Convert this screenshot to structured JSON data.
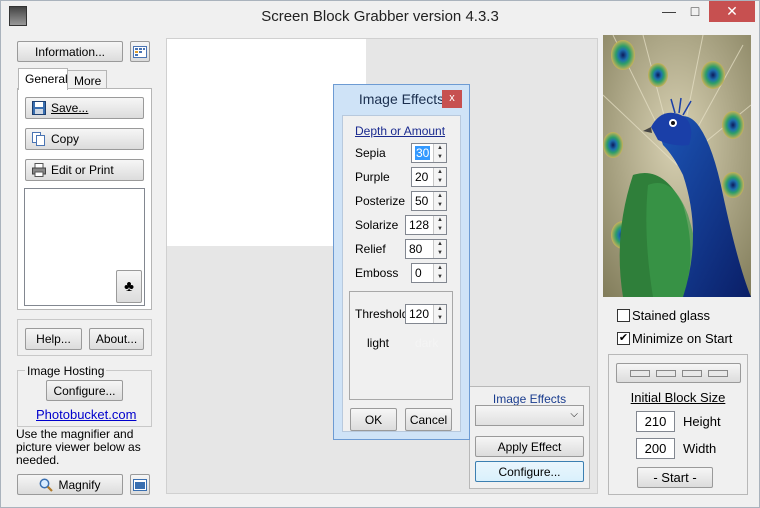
{
  "window": {
    "title": "Screen Block Grabber   version 4.3.3",
    "minimize": "—",
    "restore": "□",
    "close": "✕"
  },
  "left_panel": {
    "information_button": "Information...",
    "tabs": [
      {
        "label": "General",
        "active": true
      },
      {
        "label": "More",
        "active": false
      }
    ],
    "save_button": "Save...",
    "copy_button": "Copy",
    "edit_print_button": "Edit or Print",
    "club_glyph": "♣",
    "help_button": "Help...",
    "about_button": "About...",
    "image_hosting_label": "Image Hosting",
    "configure_button": "Configure...",
    "photobucket_link": "Photobucket.com",
    "magnifier_hint": "Use the magnifier and picture viewer below as needed.",
    "magnify_button": "Magnify"
  },
  "dialog": {
    "title": "Image Effects",
    "close_label": "x",
    "section_label": "Depth or Amount",
    "effects": [
      {
        "label": "Sepia",
        "value": "30",
        "selected": true
      },
      {
        "label": "Purple",
        "value": "20"
      },
      {
        "label": "Posterize",
        "value": "50"
      },
      {
        "label": "Solarize",
        "value": "128"
      },
      {
        "label": "Relief",
        "value": "80"
      },
      {
        "label": "Emboss",
        "value": "0"
      }
    ],
    "threshold_label": "Threshold",
    "threshold_value": "120",
    "light_label": "light",
    "dark_label": "dark",
    "ok_button": "OK",
    "cancel_button": "Cancel"
  },
  "effects_panel": {
    "label": "Image Effects",
    "dropdown_value": "",
    "apply_button": "Apply Effect",
    "configure_button": "Configure..."
  },
  "right_panel": {
    "stained_glass_label": "Stained glass",
    "stained_glass_checked": false,
    "minimize_on_start_label": "Minimize on Start",
    "minimize_on_start_checked": true,
    "initial_block_size_label": "Initial Block Size",
    "height_value": "210",
    "height_label": "Height",
    "width_value": "200",
    "width_label": "Width",
    "start_button": "- Start -"
  },
  "colors": {
    "accent": "#3399ff",
    "link": "#0000cc",
    "dialog_frame": "#cfe3f7",
    "close_red": "#c75050"
  }
}
